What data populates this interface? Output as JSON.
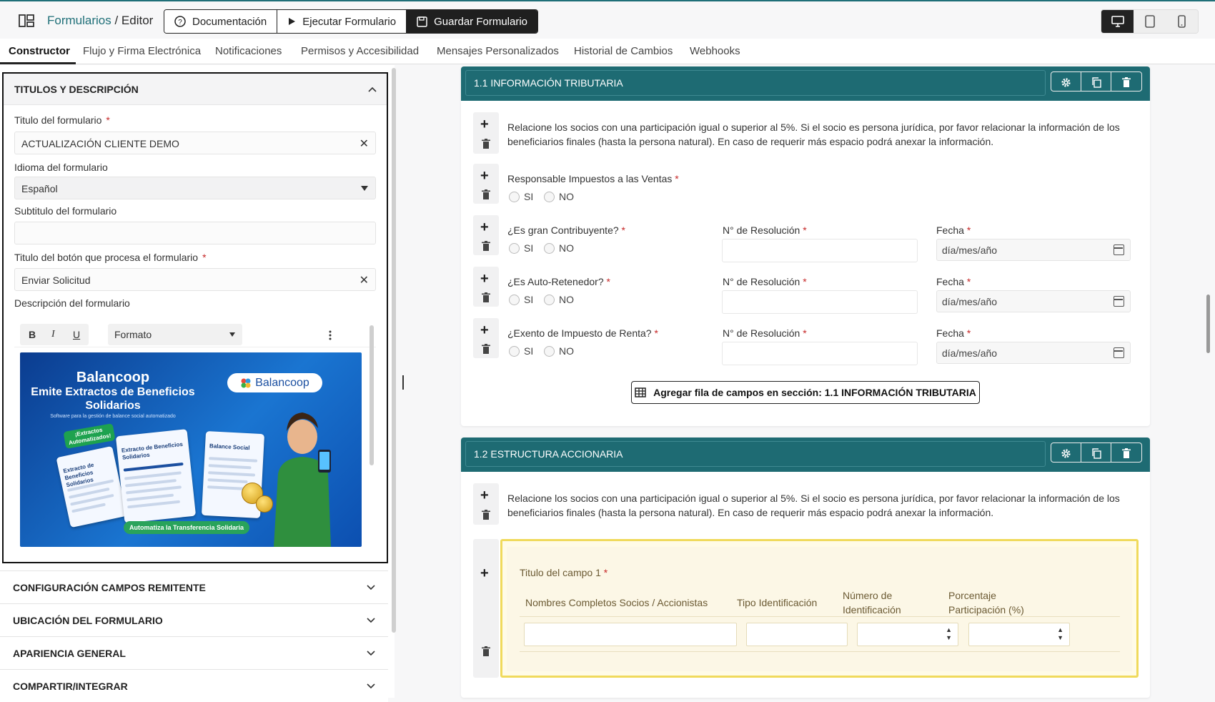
{
  "topbar": {
    "crumb_link": "Formularios",
    "crumb_sep": " / ",
    "crumb_current": "Editor",
    "btn_docs": "Documentación",
    "btn_run": "Ejecutar Formulario",
    "btn_save": "Guardar Formulario",
    "devices": [
      "desktop-icon",
      "tablet-icon",
      "mobile-icon"
    ],
    "active_device": "desktop"
  },
  "tabs": [
    "Constructor",
    "Flujo y Firma Electrónica",
    "Notificaciones",
    "Permisos y Accesibilidad",
    "Mensajes Personalizados",
    "Historial de Cambios",
    "Webhooks"
  ],
  "left": {
    "section_title": "TITULOS Y DESCRIPCIÓN",
    "form_title_label": "Titulo del formulario",
    "form_title_value": "ACTUALIZACIÓN CLIENTE DEMO",
    "lang_label": "Idioma del formulario",
    "lang_value": "Español",
    "subtitle_label": "Subtitulo del formulario",
    "subtitle_value": "",
    "btn_title_label": "Titulo del botón que procesa el formulario",
    "btn_title_value": "Enviar Solicitud",
    "desc_label": "Descripción del formulario",
    "editor": {
      "bold": "B",
      "italic": "I",
      "underline": "U",
      "format": "Formato"
    },
    "banner": {
      "brand": "Balancoop",
      "headline": "Emite Extractos de Beneficios Solidarios",
      "tagline": "Software para la gestión de balance social automatizado",
      "pill": "Balancoop",
      "chip": "¡Extractos Automatizados!",
      "doc1": "Extracto de Beneficios Solidarios",
      "doc2": "Extracto de Beneficios Solidarios",
      "doc3": "Balance Social",
      "footer": "Automatiza la Transferencia Solidaria"
    },
    "accordions": [
      "CONFIGURACIÓN CAMPOS REMITENTE",
      "UBICACIÓN DEL FORMULARIO",
      "APARIENCIA GENERAL",
      "COMPARTIR/INTEGRAR"
    ]
  },
  "sections": [
    {
      "title": "1.1 INFORMACIÓN TRIBUTARIA",
      "intro": "Relacione los socios con una participación igual o superior al 5%. Si el socio es persona jurídica, por favor relacionar la información de los beneficiarios finales (hasta la persona natural). En caso de requerir más espacio podrá anexar la información.",
      "q_ventas": "Responsable Impuestos a las Ventas",
      "q_contrib": "¿Es gran Contribuyente?",
      "q_autoret": "¿Es Auto-Retenedor?",
      "q_renta": "¿Exento de Impuesto de Renta?",
      "opt_si": "SI",
      "opt_no": "NO",
      "res_label": "N° de Resolución",
      "fecha_label": "Fecha",
      "fecha_placeholder": "día/mes/año",
      "req": "*",
      "add_row": "Agregar fila de campos en sección: 1.1 INFORMACIÓN TRIBUTARIA"
    },
    {
      "title": "1.2 ESTRUCTURA ACCIONARIA",
      "intro": "Relacione los socios con una participación igual o superior al 5%. Si el socio es persona jurídica, por favor relacionar la información de los beneficiarios finales (hasta la persona natural). En caso de requerir más espacio podrá anexar la información.",
      "field_title": "Titulo del campo 1",
      "req": "*",
      "col_names": "Nombres Completos Socios / Accionistas",
      "col_tipo": "Tipo Identificación",
      "col_num": "Número de Identificación",
      "col_pct": "Porcentaje Participación (%)"
    }
  ],
  "colors": {
    "accent": "#1e6b73",
    "required": "#c62828",
    "highlight": "#f0da5c"
  }
}
